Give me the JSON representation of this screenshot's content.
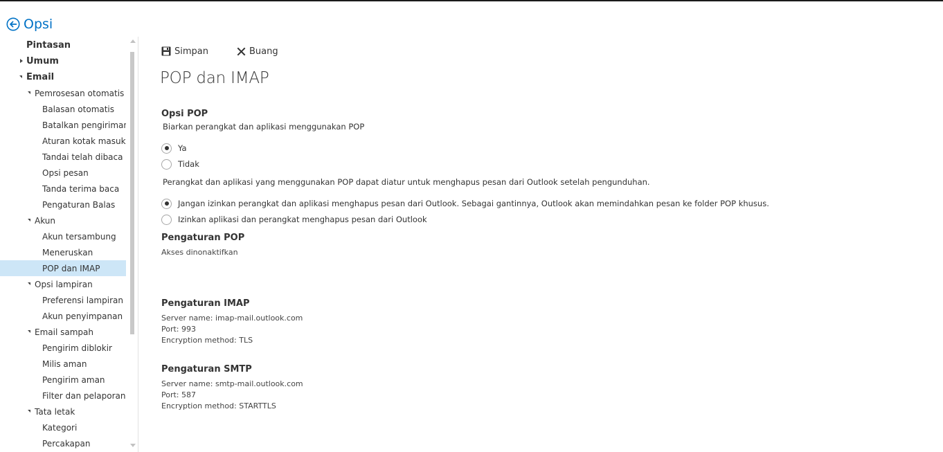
{
  "header": {
    "title": "Opsi"
  },
  "sidebar": {
    "items": [
      {
        "label": "Pintasan",
        "level": 0,
        "expander": "none"
      },
      {
        "label": "Umum",
        "level": 0,
        "expander": "collapsed"
      },
      {
        "label": "Email",
        "level": 0,
        "expander": "expanded"
      },
      {
        "label": "Pemrosesan otomatis",
        "level": 1,
        "expander": "expanded"
      },
      {
        "label": "Balasan otomatis",
        "level": 2,
        "expander": "none"
      },
      {
        "label": "Batalkan pengiriman",
        "level": 2,
        "expander": "none"
      },
      {
        "label": "Aturan kotak masuk da",
        "level": 2,
        "expander": "none"
      },
      {
        "label": "Tandai telah dibaca",
        "level": 2,
        "expander": "none"
      },
      {
        "label": "Opsi pesan",
        "level": 2,
        "expander": "none"
      },
      {
        "label": "Tanda terima baca",
        "level": 2,
        "expander": "none"
      },
      {
        "label": "Pengaturan Balas",
        "level": 2,
        "expander": "none"
      },
      {
        "label": "Akun",
        "level": 1,
        "expander": "expanded"
      },
      {
        "label": "Akun tersambung",
        "level": 2,
        "expander": "none"
      },
      {
        "label": "Meneruskan",
        "level": 2,
        "expander": "none"
      },
      {
        "label": "POP dan IMAP",
        "level": 2,
        "expander": "none",
        "selected": true
      },
      {
        "label": "Opsi lampiran",
        "level": 1,
        "expander": "expanded"
      },
      {
        "label": "Preferensi lampiran",
        "level": 2,
        "expander": "none"
      },
      {
        "label": "Akun penyimpanan",
        "level": 2,
        "expander": "none"
      },
      {
        "label": "Email sampah",
        "level": 1,
        "expander": "expanded"
      },
      {
        "label": "Pengirim diblokir",
        "level": 2,
        "expander": "none"
      },
      {
        "label": "Milis aman",
        "level": 2,
        "expander": "none"
      },
      {
        "label": "Pengirim aman",
        "level": 2,
        "expander": "none"
      },
      {
        "label": "Filter dan pelaporan",
        "level": 2,
        "expander": "none"
      },
      {
        "label": "Tata letak",
        "level": 1,
        "expander": "expanded"
      },
      {
        "label": "Kategori",
        "level": 2,
        "expander": "none"
      },
      {
        "label": "Percakapan",
        "level": 2,
        "expander": "none"
      }
    ]
  },
  "toolbar": {
    "save_label": "Simpan",
    "discard_label": "Buang"
  },
  "main": {
    "title": "POP dan IMAP",
    "pop_options": {
      "heading": "Opsi POP",
      "question": "Biarkan perangkat dan aplikasi menggunakan POP",
      "yes_label": "Ya",
      "no_label": "Tidak",
      "selected": "yes",
      "delete_description": "Perangkat dan aplikasi yang menggunakan POP dapat diatur untuk menghapus pesan dari Outlook setelah pengunduhan.",
      "no_delete_label": "Jangan izinkan perangkat dan aplikasi menghapus pesan dari Outlook. Sebagai gantinnya, Outlook akan memindahkan pesan ke folder POP khusus.",
      "allow_delete_label": "Izinkan aplikasi dan perangkat menghapus pesan dari Outlook",
      "delete_selected": "no_delete"
    },
    "pop_settings": {
      "heading": "Pengaturan POP",
      "status": "Akses dinonaktifkan"
    },
    "imap_settings": {
      "heading": "Pengaturan IMAP",
      "server": "Server name: imap-mail.outlook.com",
      "port": "Port: 993",
      "encryption": "Encryption method: TLS"
    },
    "smtp_settings": {
      "heading": "Pengaturan SMTP",
      "server": "Server name: smtp-mail.outlook.com",
      "port": "Port: 587",
      "encryption": "Encryption method: STARTTLS"
    }
  },
  "colors": {
    "accent": "#0072c6",
    "selected_bg": "#cde6f7"
  }
}
